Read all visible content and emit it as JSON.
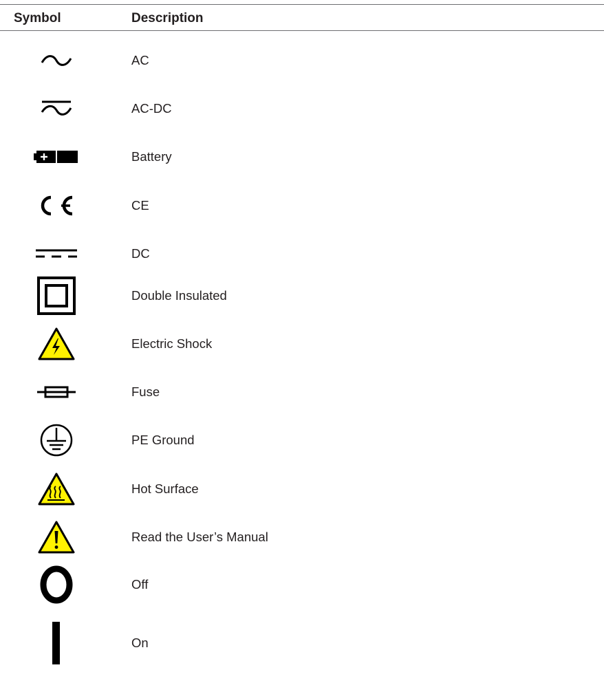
{
  "header": {
    "symbol_label": "Symbol",
    "description_label": "Description"
  },
  "colors": {
    "text": "#231f20",
    "rule": "#6d6e71",
    "warning_yellow": "#fff200",
    "icon_black": "#000000"
  },
  "rows": [
    {
      "icon": "ac-icon",
      "description": "AC"
    },
    {
      "icon": "ac-dc-icon",
      "description": "AC-DC"
    },
    {
      "icon": "battery-icon",
      "description": "Battery"
    },
    {
      "icon": "ce-mark-icon",
      "description": "CE"
    },
    {
      "icon": "dc-icon",
      "description": "DC"
    },
    {
      "icon": "double-insulated-icon",
      "description": "Double Insulated"
    },
    {
      "icon": "electric-shock-icon",
      "description": "Electric Shock"
    },
    {
      "icon": "fuse-icon",
      "description": "Fuse"
    },
    {
      "icon": "pe-ground-icon",
      "description": "PE Ground"
    },
    {
      "icon": "hot-surface-icon",
      "description": "Hot Surface"
    },
    {
      "icon": "warning-manual-icon",
      "description": "Read the User’s Manual"
    },
    {
      "icon": "off-icon",
      "description": "Off"
    },
    {
      "icon": "on-icon",
      "description": "On"
    }
  ]
}
